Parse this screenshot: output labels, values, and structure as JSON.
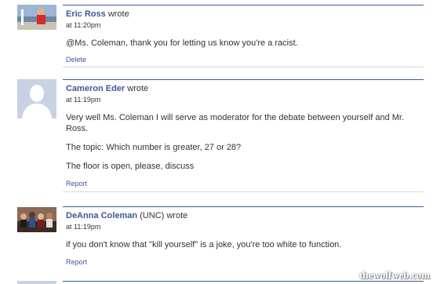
{
  "posts": [
    {
      "author": "Eric Ross",
      "wrote": "wrote",
      "time": "at 11:20pm",
      "body": [
        "@Ms. Coleman, thank you for letting us know you're a racist."
      ],
      "action": "Delete",
      "avatar": "photo"
    },
    {
      "author": "Cameron Eder",
      "wrote": "wrote",
      "time": "at 11:19pm",
      "body": [
        "Very well Ms. Coleman I will serve as moderator for the debate between yourself and Mr. Ross.",
        "The topic: Which number is greater, 27 or 28?",
        "The floor is open, please, discuss"
      ],
      "action": "Report",
      "avatar": "default-silhouette"
    },
    {
      "author": "DeAnna Coleman",
      "network": "(UNC) wrote",
      "time": "at 11:19pm",
      "body": [
        "if you don't know that \"kill yourself\" is a joke, you're too white to function."
      ],
      "action": "Report",
      "avatar": "group-photo"
    }
  ],
  "watermark": "thewolfweb.com",
  "colors": {
    "link": "#3b5998",
    "text": "#333333",
    "divider": "#d9d9d9"
  }
}
